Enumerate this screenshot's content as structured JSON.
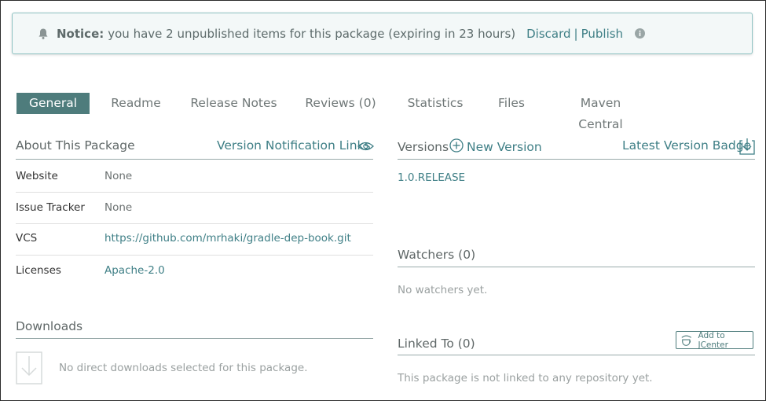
{
  "notice": {
    "label": "Notice:",
    "message": "you have 2 unpublished items for this package (expiring in 23 hours)",
    "discard": "Discard",
    "separator": "|",
    "publish": "Publish"
  },
  "tabs": [
    {
      "label": "General",
      "active": true
    },
    {
      "label": "Readme"
    },
    {
      "label": "Release Notes"
    },
    {
      "label": "Reviews (0)"
    },
    {
      "label": "Statistics"
    },
    {
      "label": "Files"
    },
    {
      "label": "Maven Central"
    }
  ],
  "about": {
    "title": "About This Package",
    "notification_link": "Version Notification Links",
    "rows": [
      {
        "label": "Website",
        "value": "None"
      },
      {
        "label": "Issue Tracker",
        "value": "None"
      },
      {
        "label": "VCS",
        "value": "https://github.com/mrhaki/gradle-dep-book.git"
      },
      {
        "label": "Licenses",
        "value": "Apache-2.0"
      }
    ]
  },
  "downloads": {
    "title": "Downloads",
    "empty": "No direct downloads selected for this package."
  },
  "versions": {
    "title": "Versions",
    "new_version": "New Version",
    "badge": "Latest Version Badge",
    "items": [
      "1.0.RELEASE"
    ]
  },
  "watchers": {
    "title": "Watchers (0)",
    "empty": "No watchers yet."
  },
  "linked": {
    "title": "Linked To (0)",
    "button": "Add to JCenter",
    "empty": "This package is not linked to any repository yet."
  },
  "colors": {
    "accent": "#4e7c7c",
    "link": "#3f7f86",
    "notice_border": "#8fc3c3"
  }
}
